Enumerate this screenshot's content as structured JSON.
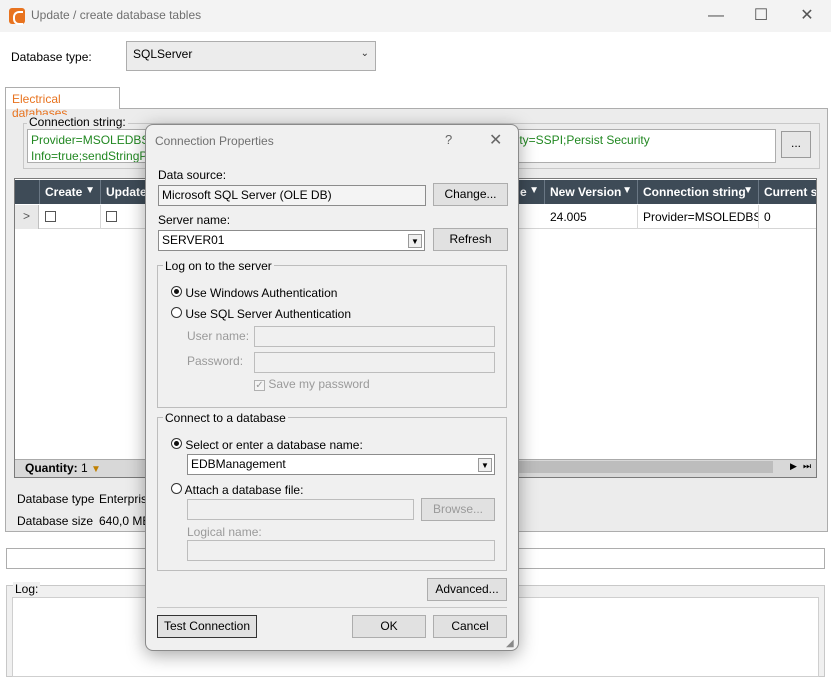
{
  "window": {
    "title": "Update / create database tables",
    "minimize": "—",
    "maximize": "☐",
    "close": "✕"
  },
  "db_type": {
    "label": "Database type:",
    "value": "SQLServer"
  },
  "tabs": [
    {
      "label": "Electrical databases",
      "active": true
    }
  ],
  "connection": {
    "label": "Connection string:",
    "value_line1": "Provider=MSOLEDBS",
    "value_line1_right": "urity=SSPI;Persist Security",
    "value_line2": "Info=true;sendStringP",
    "browse_label": "..."
  },
  "grid": {
    "columns_left": [
      "Create",
      "Update"
    ],
    "columns_right": [
      "e",
      "New Version",
      "Connection string",
      "Current st"
    ],
    "row": {
      "indicator": ">",
      "new_version": "24.005",
      "connection_string": "Provider=MSOLEDBS",
      "current": "0"
    },
    "footer": {
      "quantity_label": "Quantity:",
      "quantity_value": "1"
    }
  },
  "info": {
    "type_label": "Database type",
    "type_value": "Enterpris",
    "size_label": "Database size",
    "size_value": "640,0 ME"
  },
  "log": {
    "label": "Log:"
  },
  "dialog": {
    "title": "Connection Properties",
    "help": "?",
    "close": "✕",
    "data_source_label": "Data source:",
    "data_source_value": "Microsoft SQL Server (OLE DB)",
    "change_button": "Change...",
    "server_name_label": "Server name:",
    "server_name_value": "SERVER01",
    "refresh_button": "Refresh",
    "logon_group": "Log on to the server",
    "use_windows_auth": "Use Windows Authentication",
    "use_sql_auth": "Use SQL Server Authentication",
    "user_name_label": "User name:",
    "password_label": "Password:",
    "save_password": "Save my password",
    "connect_group": "Connect to a database",
    "select_db_label": "Select or enter a database name:",
    "db_name_value": "EDBManagement",
    "attach_file_label": "Attach a database file:",
    "browse_button": "Browse...",
    "logical_name_label": "Logical name:",
    "advanced_button": "Advanced...",
    "test_connection_button": "Test Connection",
    "ok_button": "OK",
    "cancel_button": "Cancel"
  },
  "colors": {
    "accent": "#e8731f",
    "grid_header": "#3e4b57",
    "conn_text": "#228822"
  }
}
